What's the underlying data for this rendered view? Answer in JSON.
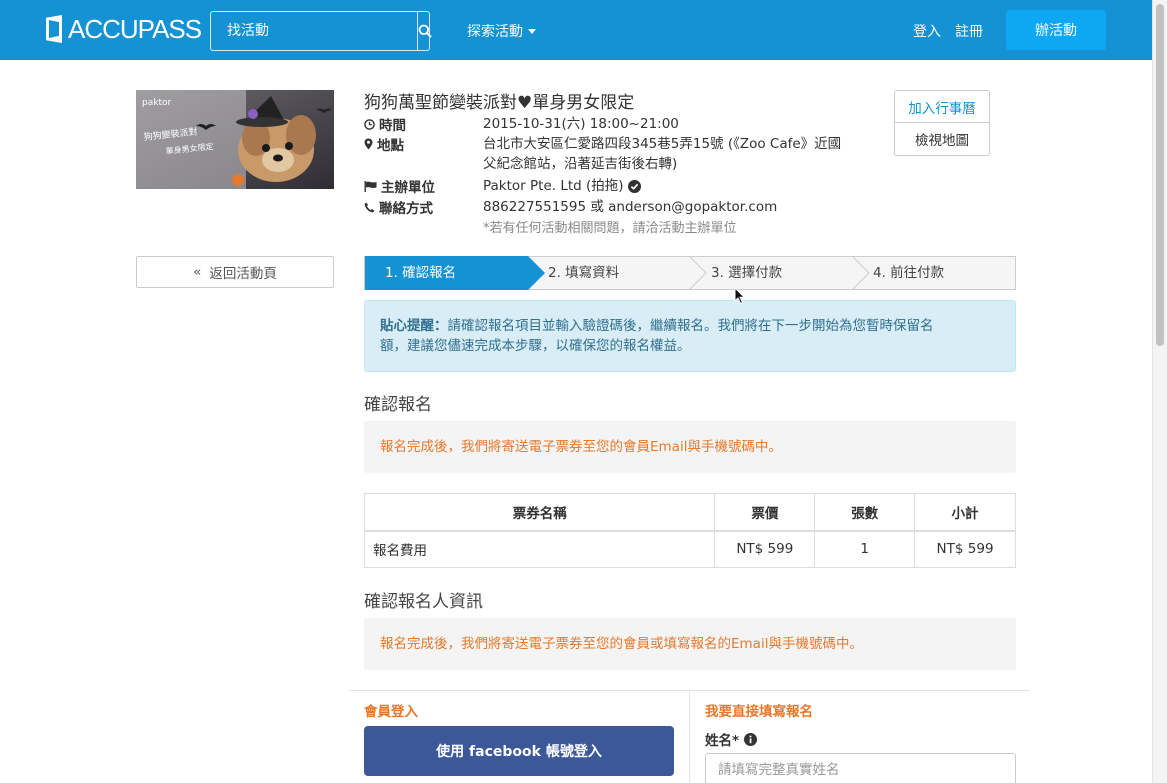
{
  "header": {
    "logo_text": "ACCUPASS",
    "search_placeholder": "找活動",
    "explore_label": "探索活動",
    "login_label": "登入",
    "register_label": "註冊",
    "host_label": "辦活動"
  },
  "event": {
    "title": "狗狗萬聖節變裝派對♥單身男女限定",
    "time_label": "時間",
    "time_value": "2015-10-31(六) 18:00~21:00",
    "location_label": "地點",
    "location_line1": "台北市大安區仁愛路四段345巷5弄15號 (《Zoo Cafe》近國",
    "location_line2": "父紀念館站，沿著延吉街後右轉)",
    "organizer_label": "主辦單位",
    "organizer_value": "Paktor Pte. Ltd (拍拖)",
    "contact_label": "聯絡方式",
    "contact_value": "886227551595 或 anderson@gopaktor.com",
    "note": "*若有任何活動相關問題，請洽活動主辦單位",
    "add_calendar_label": "加入行事曆",
    "view_map_label": "檢視地圖",
    "back_label": "返回活動頁",
    "image_text": {
      "logo": "paktor",
      "line1": "狗狗變裝派對",
      "line2": "單身男女限定"
    }
  },
  "steps": [
    {
      "label": "1. 確認報名"
    },
    {
      "label": "2. 填寫資料"
    },
    {
      "label": "3. 選擇付款"
    },
    {
      "label": "4. 前往付款"
    }
  ],
  "tip": {
    "bold": "貼心提醒：",
    "line1": "請確認報名項目並輸入驗證碼後，繼續報名。我們將在下一步開始為您暫時保留名",
    "line2": "額，建議您儘速完成本步驟，以確保您的報名權益。"
  },
  "confirm": {
    "title": "確認報名",
    "notice": "報名完成後，我們將寄送電子票券至您的會員Email與手機號碼中。"
  },
  "ticket_table": {
    "headers": [
      "票券名稱",
      "票價",
      "張數",
      "小計"
    ],
    "rows": [
      [
        "報名費用",
        "NT$ 599",
        "1",
        "NT$ 599"
      ]
    ]
  },
  "registrant": {
    "title": "確認報名人資訊",
    "notice": "報名完成後，我們將寄送電子票券至您的會員或填寫報名的Email與手機號碼中。",
    "member_login_title": "會員登入",
    "facebook_button": "使用 facebook 帳號登入",
    "direct_title": "我要直接填寫報名",
    "name_label": "姓名*",
    "name_placeholder": "請填寫完整真實姓名"
  },
  "colors": {
    "brand_blue": "#1592d3",
    "host_button": "#0da7f3",
    "warning_orange": "#e8792b",
    "facebook": "#3b5998"
  }
}
